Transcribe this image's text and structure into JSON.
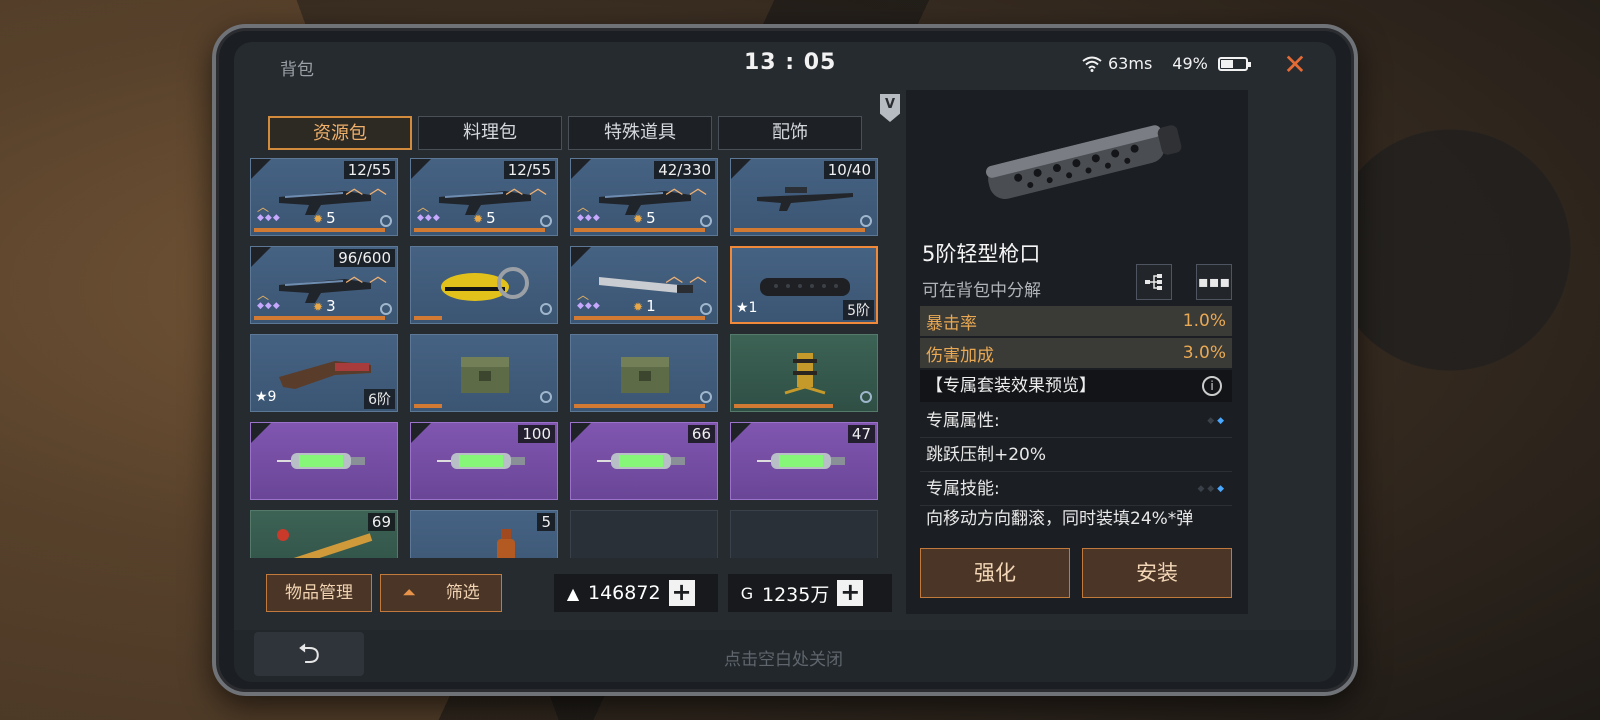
{
  "status": {
    "title": "背包",
    "time": "13 : 05",
    "ping": "63ms",
    "battery": "49%",
    "battery_level": 0.49,
    "close": "✕"
  },
  "tabs": [
    {
      "label": "资源包",
      "active": true
    },
    {
      "label": "料理包"
    },
    {
      "label": "特殊道具"
    },
    {
      "label": "配饰"
    }
  ],
  "vip_badge": "V",
  "grid": {
    "slots": [
      {
        "kind": "rifle",
        "count": "12/55",
        "level": "5",
        "style": "blue",
        "icon": "rifle-art",
        "bar": 0.92
      },
      {
        "kind": "rifle",
        "count": "12/55",
        "level": "5",
        "style": "blue",
        "icon": "rifle-art",
        "bar": 0.92
      },
      {
        "kind": "rifle",
        "count": "42/330",
        "level": "5",
        "style": "blue",
        "icon": "rifle-art",
        "bar": 0.92
      },
      {
        "kind": "sniper",
        "count": "10/40",
        "style": "blue",
        "icon": "sniper-art",
        "bar": 0.92
      },
      {
        "kind": "rifle",
        "count": "96/600",
        "level": "3",
        "style": "blue",
        "icon": "rifle-art",
        "bar": 0.92
      },
      {
        "kind": "chainsaw",
        "style": "blue",
        "icon": "chainsaw-art",
        "bar": 0.2
      },
      {
        "kind": "machete",
        "level": "1",
        "style": "blue",
        "icon": "machete-art",
        "bar": 0.92
      },
      {
        "kind": "silencer",
        "star": "1",
        "tier": "5阶",
        "style": "blue",
        "selected": true,
        "icon": "silencer-art"
      },
      {
        "kind": "stock",
        "star": "9",
        "tier": "6阶",
        "style": "blue",
        "icon": "stock-art"
      },
      {
        "kind": "crate",
        "style": "blue",
        "icon": "crate-art",
        "bar": 0.2
      },
      {
        "kind": "crate",
        "style": "blue",
        "icon": "crate-art",
        "bar": 0.92
      },
      {
        "kind": "turret",
        "style": "green",
        "icon": "turret-art",
        "bar": 0.7
      },
      {
        "kind": "syringe",
        "style": "purple",
        "icon": "syringe-art"
      },
      {
        "kind": "syringe",
        "count": "100",
        "style": "purple",
        "icon": "syringe-art"
      },
      {
        "kind": "syringe",
        "count": "66",
        "style": "purple",
        "icon": "syringe-art"
      },
      {
        "kind": "syringe",
        "count": "47",
        "style": "purple",
        "icon": "syringe-art"
      },
      {
        "kind": "item",
        "count": "69",
        "style": "green",
        "icon": "item-art"
      },
      {
        "kind": "item",
        "count": "5",
        "style": "blue",
        "icon": "bottle-art"
      },
      {
        "kind": "empty",
        "style": "empty"
      },
      {
        "kind": "empty",
        "style": "empty"
      }
    ]
  },
  "footer": {
    "manage": "物品管理",
    "filter": "筛选",
    "currency_a": {
      "icon": "bullion-icon",
      "value": "146872"
    },
    "currency_b": {
      "icon": "coin-icon",
      "value": "1235万"
    }
  },
  "detail": {
    "name": "5阶轻型枪口",
    "sub": "可在背包中分解",
    "stats": [
      {
        "k": "暴击率",
        "v": "1.0%"
      },
      {
        "k": "伤害加成",
        "v": "3.0%"
      }
    ],
    "set_preview": "【专属套装效果预览】",
    "attr_label": "专属属性:",
    "attr_value": "跳跃压制+20%",
    "skill_label": "专属技能:",
    "skill_value": "向移动方向翻滚，同时装填24%*弹",
    "upgrade": "强化",
    "install": "安装"
  },
  "bottom": {
    "back": "⮌",
    "hint": "点击空白处关闭"
  }
}
